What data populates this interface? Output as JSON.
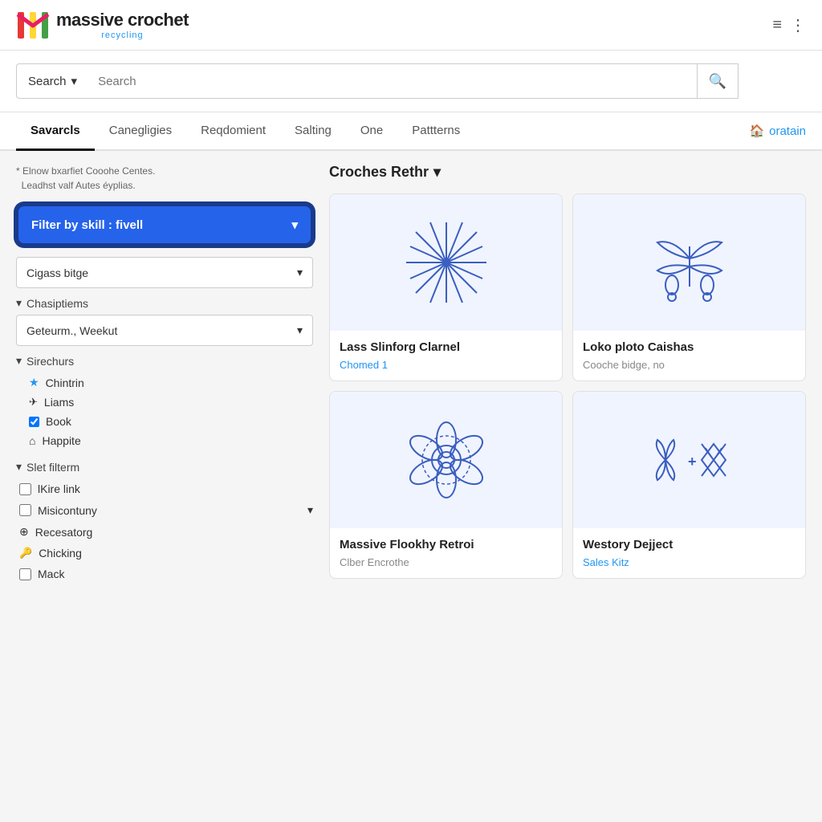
{
  "header": {
    "logo_title": "massive crochet",
    "logo_subtitle": "recycling",
    "menu_icon": "≡",
    "dots_icon": "⋮"
  },
  "search_bar": {
    "dropdown_label": "Search",
    "dropdown_chevron": "▾",
    "input_placeholder": "Search",
    "search_icon": "🔍"
  },
  "nav": {
    "tabs": [
      {
        "label": "Savarcls",
        "active": true
      },
      {
        "label": "Canegligies",
        "active": false
      },
      {
        "label": "Reqdomient",
        "active": false
      },
      {
        "label": "Salting",
        "active": false
      },
      {
        "label": "One",
        "active": false
      },
      {
        "label": "Pattterns",
        "active": false
      }
    ],
    "user_tab": "oratain"
  },
  "sidebar": {
    "note": "* Elnow bxarfiet Cooohe Centes.\n  Leadhst valf Autes éyplias.",
    "filter_btn_label": "Filter by skill : fivell",
    "filter_btn_chevron": "▾",
    "dropdown_label": "Cigass bitge",
    "dropdown_chevron": "▾",
    "section_chasiptiems": {
      "header": "Chasiptiems",
      "chevron": "▾",
      "dropdown_label": "Geteurm., Weekut",
      "dropdown_chevron": "▾"
    },
    "section_sirechurs": {
      "header": "Sirechurs",
      "chevron": "▾",
      "items": [
        {
          "icon": "★",
          "label": "Chintrin"
        },
        {
          "icon": "✈",
          "label": "Liams"
        },
        {
          "icon": "☑",
          "label": "Book",
          "checked": true
        },
        {
          "icon": "⌂",
          "label": "Happite"
        }
      ]
    },
    "section_slet": {
      "header": "Slet filterm",
      "chevron": "▾",
      "items": [
        {
          "type": "checkbox",
          "label": "lKire link",
          "checked": false
        },
        {
          "type": "checkbox-arrow",
          "label": "Misicontuny",
          "checked": false,
          "has_arrow": true
        },
        {
          "type": "globe",
          "label": "Recesatorg"
        },
        {
          "type": "key",
          "label": "Chicking"
        },
        {
          "type": "checkbox",
          "label": "Mack",
          "checked": false
        }
      ]
    }
  },
  "products": {
    "header": "Croches Rethr",
    "header_chevron": "▾",
    "cards": [
      {
        "title": "Lass Slinforg Clarnel",
        "subtitle": "Chomed 1",
        "subtitle_color": "blue",
        "pattern": "starburst"
      },
      {
        "title": "Loko ploto Caishas",
        "subtitle": "Cooche bidge, no",
        "subtitle_color": "gray",
        "pattern": "butterfly"
      },
      {
        "title": "Massive Flookhy Retroi",
        "subtitle": "Clber Encrothe",
        "subtitle_color": "gray",
        "pattern": "flower"
      },
      {
        "title": "Westory Dejject",
        "subtitle": "Sales Kitz",
        "subtitle_color": "blue",
        "pattern": "diamond-cross"
      }
    ]
  }
}
